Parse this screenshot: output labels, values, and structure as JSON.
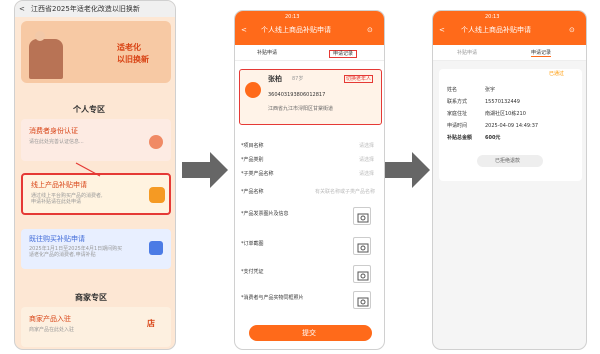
{
  "p1": {
    "title": "江西省2025年适老化改造以旧换新",
    "banner1": "适老化",
    "banner2": "以旧换新",
    "section1": "个人专区",
    "c1_title": "消费者身份认证",
    "c1_desc": "请在此处完善认证信息...",
    "c2_title": "线上产品补贴申请",
    "c2_desc1": "通过线上平台购买产品的消费者,",
    "c2_desc2": "申请补贴请在此处申请",
    "c3_title": "既往购买补贴申请",
    "c3_desc1": "2025年1月1日至2025年4月1日期间购买",
    "c3_desc2": "适老化产品的消费者,申请补贴",
    "section2": "商家专区",
    "c4_title": "商家产品入驻",
    "c4_desc": "商家产品在此处入驻"
  },
  "p2": {
    "time": "20:13",
    "title": "个人线上商品补贴申请",
    "tab1": "补贴申请",
    "tab2": "申请记录",
    "name": "张柏",
    "tag": "87岁",
    "id": "360403193806012817",
    "addr": "江西省九江市浔阳区甘棠街道",
    "badge": "切换老年人",
    "f1": "*项目名称",
    "v1": "请选择",
    "f2": "*产品类别",
    "v2": "请选择",
    "f3": "*子类产品名称",
    "v3": "请选择",
    "f4": "*产品名称",
    "v4": "有关联名称或子类产品名称",
    "f5": "*产品发票图片及信息",
    "f6": "*订单截图",
    "f7": "*支付凭证",
    "f8": "*消费者与产品实物同框照片",
    "submit": "提交"
  },
  "p3": {
    "time": "20:13",
    "title": "个人线上商品补贴申请",
    "tab1": "补贴申请",
    "tab2": "申请记录",
    "status": "已通过",
    "r1k": "姓名",
    "r1v": "张宇",
    "r2k": "联系方式",
    "r2v": "15570132449",
    "r3k": "家庭住址",
    "r3v": "南湖社区10栋210",
    "r4k": "申请时间",
    "r4v": "2025-04-09 14:49:37",
    "r5k": "补贴总金额",
    "r5v": "600元",
    "btn": "已拒绝退款"
  },
  "colors": {
    "orange": "#ff6a1a",
    "red": "#e53935",
    "peach": "#fde7d4"
  }
}
